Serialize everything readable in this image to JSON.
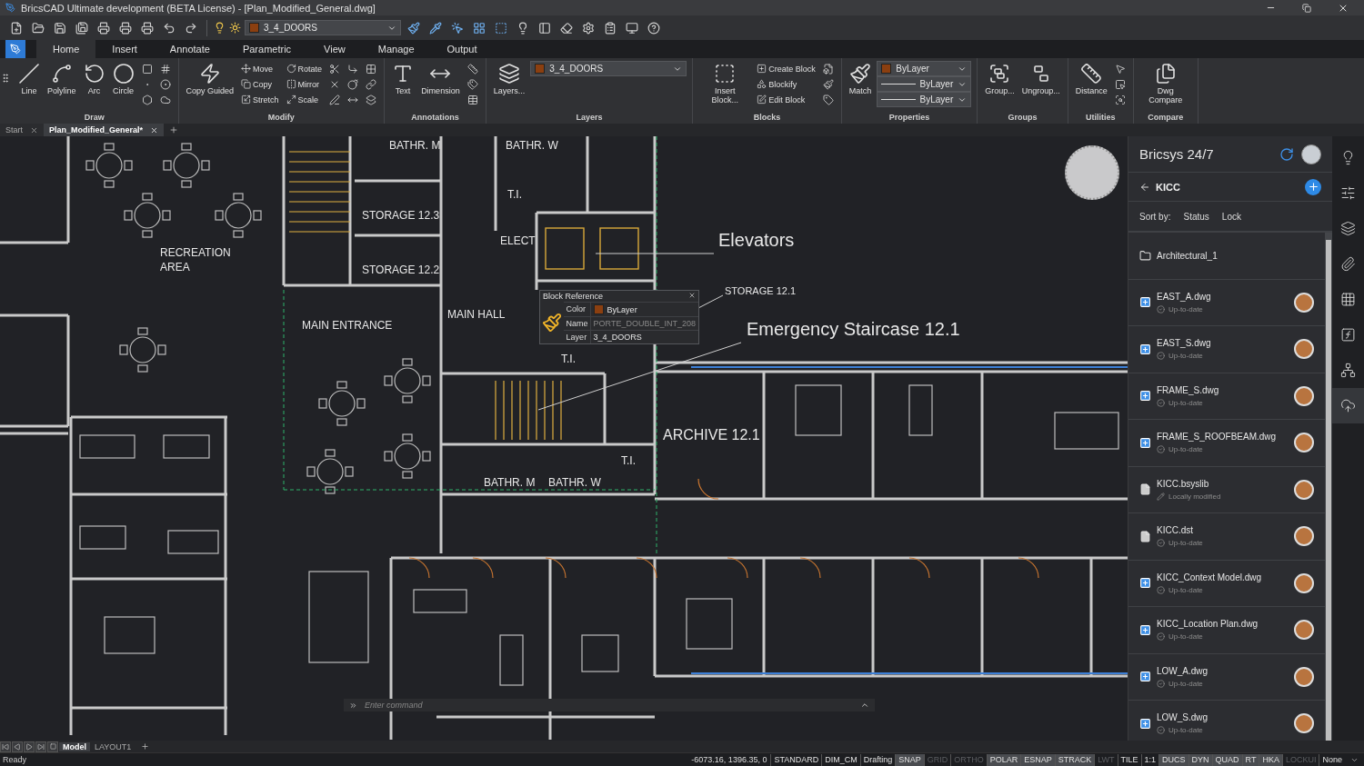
{
  "window": {
    "title": "BricsCAD Ultimate development (BETA License) - [Plan_Modified_General.dwg]"
  },
  "quick_access": {
    "layer": "3_4_DOORS"
  },
  "ribbon_tabs": [
    {
      "label": "Home",
      "selected": true
    },
    {
      "label": "Insert",
      "selected": false
    },
    {
      "label": "Annotate",
      "selected": false
    },
    {
      "label": "Parametric",
      "selected": false
    },
    {
      "label": "View",
      "selected": false
    },
    {
      "label": "Manage",
      "selected": false
    },
    {
      "label": "Output",
      "selected": false
    }
  ],
  "ribbon_panels": [
    {
      "title": "Draw",
      "items": [
        {
          "kind": "large",
          "label": "Line"
        },
        {
          "kind": "large",
          "label": "Polyline"
        },
        {
          "kind": "large",
          "label": "Arc"
        },
        {
          "kind": "large",
          "label": "Circle"
        },
        {
          "kind": "icon"
        },
        {
          "kind": "icon"
        },
        {
          "kind": "icon"
        },
        {
          "kind": "icon"
        },
        {
          "kind": "icon"
        },
        {
          "kind": "icon"
        }
      ]
    },
    {
      "title": "Modify",
      "items": [
        {
          "kind": "large",
          "label": "Copy Guided"
        },
        {
          "kind": "small",
          "label": "Move"
        },
        {
          "kind": "small",
          "label": "Copy"
        },
        {
          "kind": "small",
          "label": "Stretch"
        },
        {
          "kind": "small",
          "label": "Rotate"
        },
        {
          "kind": "small",
          "label": "Mirror"
        },
        {
          "kind": "small",
          "label": "Scale"
        },
        {
          "kind": "icon"
        },
        {
          "kind": "icon"
        },
        {
          "kind": "icon"
        },
        {
          "kind": "icon"
        },
        {
          "kind": "icon"
        },
        {
          "kind": "icon"
        },
        {
          "kind": "icon"
        },
        {
          "kind": "icon"
        },
        {
          "kind": "icon"
        }
      ]
    },
    {
      "title": "Annotations",
      "items": [
        {
          "kind": "large",
          "label": "Text"
        },
        {
          "kind": "large",
          "label": "Dimension"
        },
        {
          "kind": "icon"
        },
        {
          "kind": "icon"
        },
        {
          "kind": "icon"
        }
      ]
    },
    {
      "title": "Layers",
      "items": [
        {
          "kind": "large",
          "label": "Layers..."
        },
        {
          "kind": "select",
          "value": "3_4_DOORS"
        }
      ]
    },
    {
      "title": "Blocks",
      "items": [
        {
          "kind": "large",
          "label": "Insert Block..."
        },
        {
          "kind": "small",
          "label": "Create Block"
        },
        {
          "kind": "small",
          "label": "Blockify"
        },
        {
          "kind": "small",
          "label": "Edit Block"
        },
        {
          "kind": "icon"
        },
        {
          "kind": "icon"
        },
        {
          "kind": "icon"
        }
      ]
    },
    {
      "title": "Properties",
      "items": [
        {
          "kind": "large",
          "label": "Match"
        },
        {
          "kind": "select",
          "value": "ByLayer"
        },
        {
          "kind": "select",
          "value": "ByLayer"
        },
        {
          "kind": "select",
          "value": "ByLayer"
        }
      ]
    },
    {
      "title": "Groups",
      "items": [
        {
          "kind": "large",
          "label": "Group..."
        },
        {
          "kind": "large",
          "label": "Ungroup..."
        }
      ]
    },
    {
      "title": "Utilities",
      "items": [
        {
          "kind": "large",
          "label": "Distance"
        },
        {
          "kind": "icon"
        },
        {
          "kind": "icon"
        },
        {
          "kind": "icon"
        }
      ]
    },
    {
      "title": "Compare",
      "items": [
        {
          "kind": "large",
          "label": "Dwg Compare"
        }
      ]
    }
  ],
  "document_tabs": [
    {
      "label": "Start",
      "selected": false
    },
    {
      "label": "Plan_Modified_General*",
      "selected": true
    }
  ],
  "drawing_labels": [
    {
      "kind": "room",
      "text": "BATHR. M"
    },
    {
      "kind": "room",
      "text": "BATHR. W"
    },
    {
      "kind": "room",
      "text": "STORAGE 12.3"
    },
    {
      "kind": "room",
      "text": "T.I."
    },
    {
      "kind": "room",
      "text": "STORAGE 12.2"
    },
    {
      "kind": "room",
      "text": "ELECT"
    },
    {
      "kind": "room",
      "text": "RECREATION"
    },
    {
      "kind": "room",
      "text": "AREA"
    },
    {
      "kind": "callout",
      "text": "Elevators"
    },
    {
      "kind": "small",
      "text": "STORAGE 12.1"
    },
    {
      "kind": "room",
      "text": "MAIN ENTRANCE"
    },
    {
      "kind": "room",
      "text": "MAIN HALL"
    },
    {
      "kind": "callout",
      "text": "Emergency Staircase 12.1"
    },
    {
      "kind": "room",
      "text": "T.I."
    },
    {
      "kind": "big",
      "text": "ARCHIVE 12.1"
    },
    {
      "kind": "room",
      "text": "BATHR. M"
    },
    {
      "kind": "room",
      "text": "BATHR. W"
    },
    {
      "kind": "room",
      "text": "T.I."
    }
  ],
  "block_reference": {
    "title": "Block Reference",
    "rows": [
      {
        "label": "Color",
        "value": "ByLayer",
        "kind": "color"
      },
      {
        "label": "Name",
        "value": "PORTE_DOUBLE_INT_208",
        "kind": "dim"
      },
      {
        "label": "Layer",
        "value": "3_4_DOORS",
        "kind": "text"
      }
    ]
  },
  "command_line": {
    "placeholder": "Enter command"
  },
  "panel": {
    "title": "Bricsys 24/7",
    "project": "KICC",
    "sort_label": "Sort by:",
    "sort_options": [
      "Status",
      "Lock"
    ],
    "items": [
      {
        "kind": "folder",
        "name": "Architectural_1"
      },
      {
        "kind": "dwg",
        "name": "EAST_A.dwg",
        "status": "Up-to-date"
      },
      {
        "kind": "dwg",
        "name": "EAST_S.dwg",
        "status": "Up-to-date"
      },
      {
        "kind": "dwg",
        "name": "FRAME_S.dwg",
        "status": "Up-to-date"
      },
      {
        "kind": "dwg",
        "name": "FRAME_S_ROOFBEAM.dwg",
        "status": "Up-to-date"
      },
      {
        "kind": "doc",
        "name": "KICC.bsyslib",
        "status": "Locally modified"
      },
      {
        "kind": "doc",
        "name": "KICC.dst",
        "status": "Up-to-date"
      },
      {
        "kind": "dwg",
        "name": "KICC_Context Model.dwg",
        "status": "Up-to-date"
      },
      {
        "kind": "dwg",
        "name": "KICC_Location Plan.dwg",
        "status": "Up-to-date"
      },
      {
        "kind": "dwg",
        "name": "LOW_A.dwg",
        "status": "Up-to-date"
      },
      {
        "kind": "dwg",
        "name": "LOW_S.dwg",
        "status": "Up-to-date"
      }
    ]
  },
  "tool_strip": [
    {
      "selected": false
    },
    {
      "selected": false
    },
    {
      "selected": false
    },
    {
      "selected": false
    },
    {
      "selected": false
    },
    {
      "selected": false
    },
    {
      "selected": false
    },
    {
      "selected": true
    }
  ],
  "layout_tabs": [
    {
      "label": "Model",
      "selected": true
    },
    {
      "label": "LAYOUT1",
      "selected": false
    }
  ],
  "status_bar": {
    "message": "Ready",
    "coordinates": "-6073.16, 1396.35, 0",
    "items": [
      {
        "kind": "label",
        "label": "STANDARD"
      },
      {
        "kind": "label",
        "label": "DIM_CM"
      },
      {
        "kind": "label",
        "label": "Drafting"
      },
      {
        "kind": "toggle",
        "label": "SNAP",
        "on": true
      },
      {
        "kind": "toggle",
        "label": "GRID",
        "on": false
      },
      {
        "kind": "toggle",
        "label": "ORTHO",
        "on": false
      },
      {
        "kind": "toggle",
        "label": "POLAR",
        "on": true
      },
      {
        "kind": "toggle",
        "label": "ESNAP",
        "on": true
      },
      {
        "kind": "toggle",
        "label": "STRACK",
        "on": true
      },
      {
        "kind": "toggle",
        "label": "LWT",
        "on": false
      },
      {
        "kind": "label",
        "label": "TILE"
      },
      {
        "kind": "label",
        "label": "1:1"
      },
      {
        "kind": "toggle",
        "label": "DUCS",
        "on": true
      },
      {
        "kind": "toggle",
        "label": "DYN",
        "on": true
      },
      {
        "kind": "toggle",
        "label": "QUAD",
        "on": true
      },
      {
        "kind": "toggle",
        "label": "RT",
        "on": true
      },
      {
        "kind": "toggle",
        "label": "HKA",
        "on": true
      },
      {
        "kind": "toggle",
        "label": "LOCKUI",
        "on": false
      },
      {
        "kind": "label",
        "label": "None"
      }
    ]
  }
}
